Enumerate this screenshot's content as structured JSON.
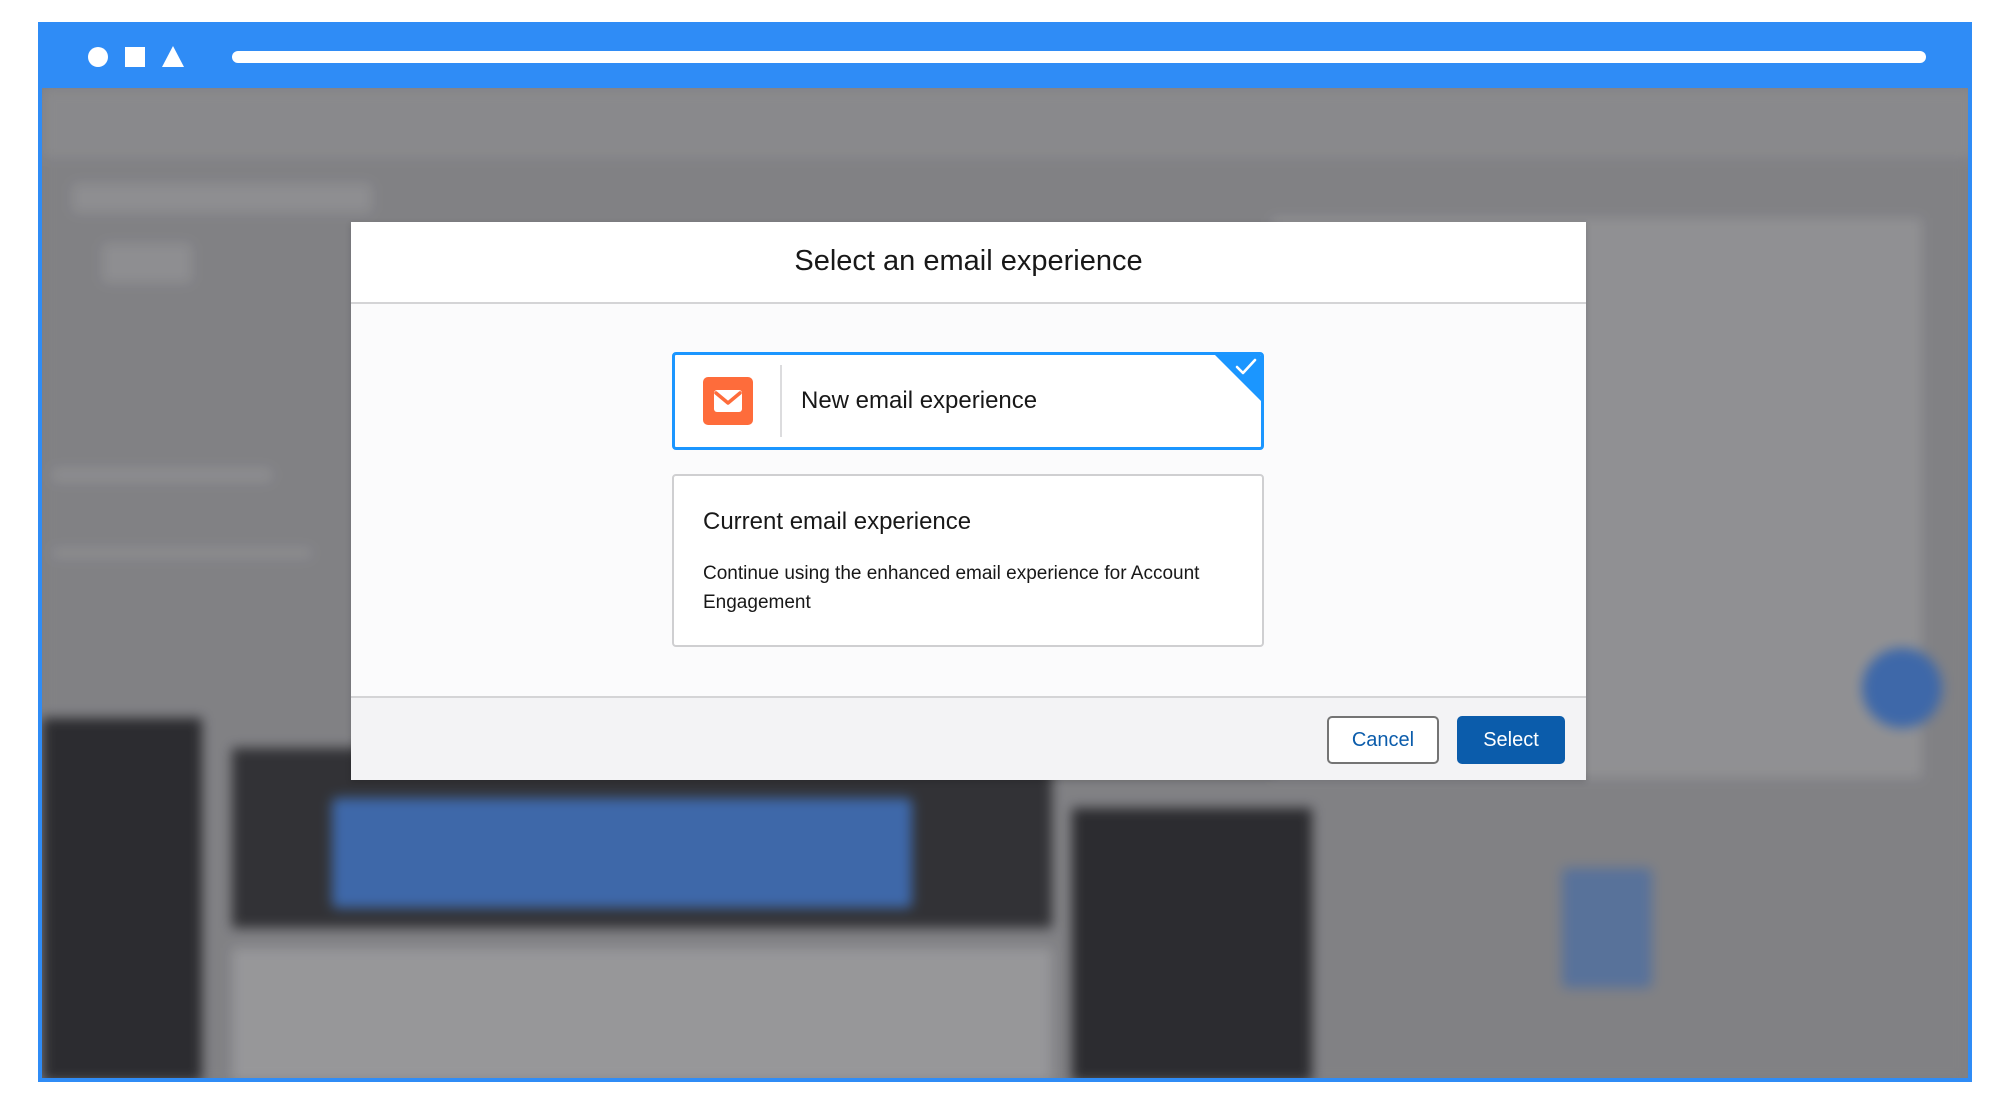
{
  "dialog": {
    "title": "Select an email experience",
    "options": [
      {
        "label": "New email experience",
        "selected": true,
        "icon": "email-icon"
      },
      {
        "title": "Current email experience",
        "description": "Continue using the enhanced email experience for Account Engagement",
        "selected": false
      }
    ],
    "buttons": {
      "cancel_label": "Cancel",
      "select_label": "Select"
    }
  },
  "colors": {
    "browser_chrome": "#2f8cf6",
    "selected_border": "#1b96ff",
    "email_icon_bg": "#fe6c3b",
    "primary_button": "#0b5cab"
  }
}
